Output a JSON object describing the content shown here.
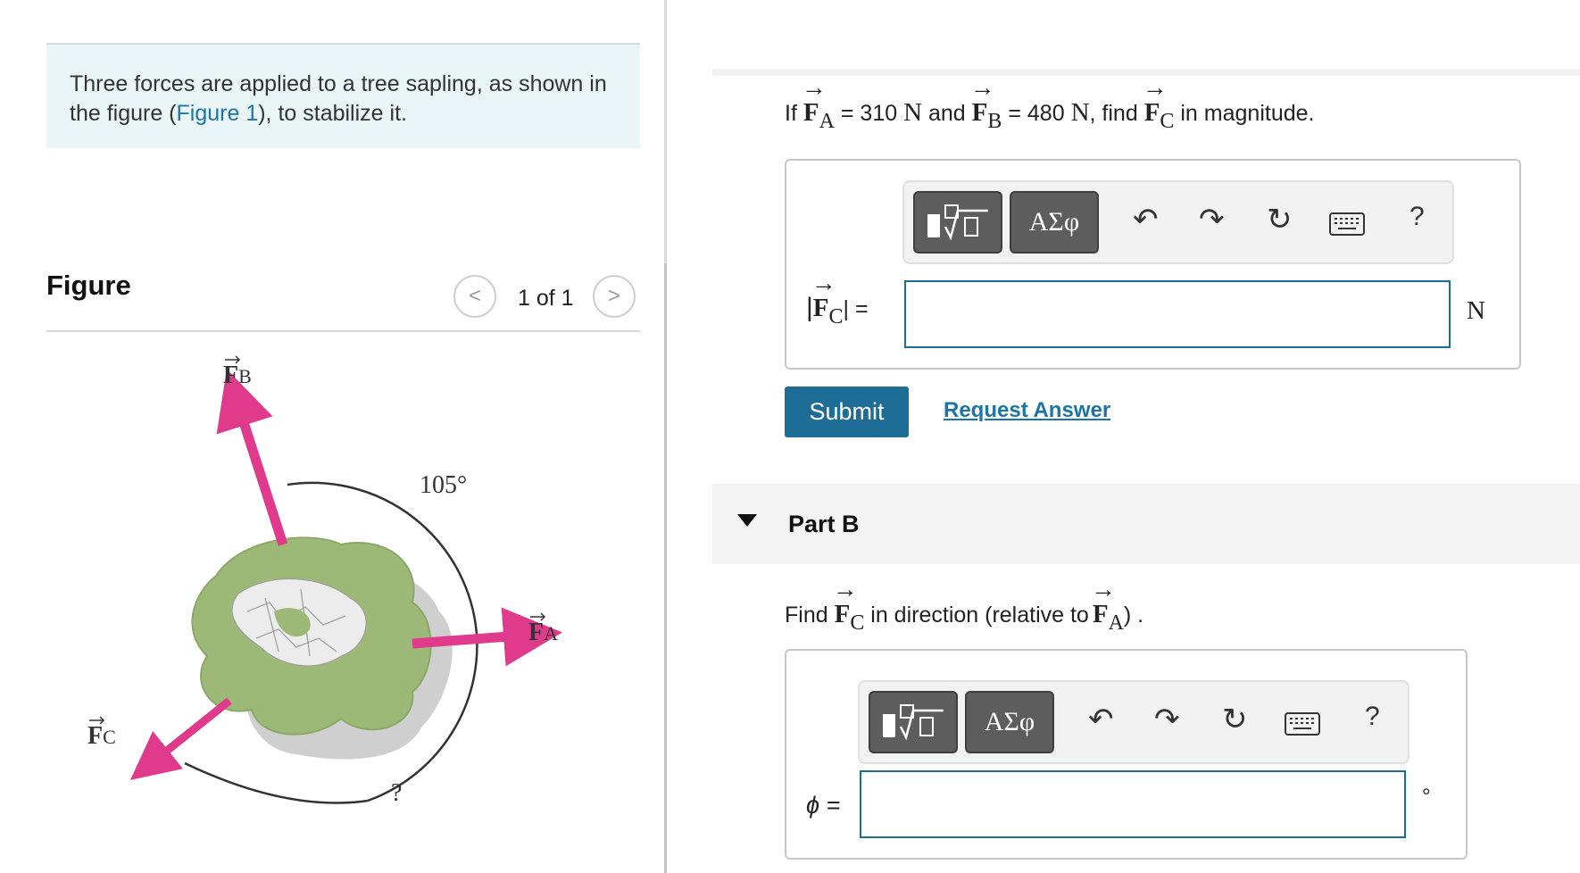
{
  "problem": {
    "text_before": "Three forces are applied to a tree sapling, as shown in the figure (",
    "link": "Figure 1",
    "text_after": "), to stabilize it."
  },
  "figure_panel": {
    "title": "Figure",
    "pager": "1 of 1",
    "prev": "<",
    "next": ">",
    "label_fb": "F",
    "label_fb_sub": "B",
    "label_fa": "F",
    "label_fa_sub": "A",
    "label_fc": "F",
    "label_fc_sub": "C",
    "angle_label": "105°",
    "unknown_angle": "?",
    "colors": {
      "arrow": "#e03a8c",
      "foliage": "#9cb978",
      "shadow": "#cfcfcf"
    }
  },
  "part_a": {
    "q_if": "If",
    "fa_letter": "F",
    "fa_sub": "A",
    "fa_eq": "= 310",
    "unit_n": "N",
    "and": "and",
    "fb_letter": "F",
    "fb_sub": "B",
    "fb_eq": "= 480",
    "find": ", find",
    "fc_letter": "F",
    "fc_sub": "C",
    "tail": "in magnitude.",
    "answer_label_letter": "F",
    "answer_label_sub": "C",
    "answer_label_eq": "| =",
    "answer_value": "",
    "answer_unit": "N",
    "submit": "Submit",
    "request": "Request Answer"
  },
  "toolbar": {
    "greek": "ΑΣφ",
    "help": "?"
  },
  "part_b": {
    "title": "Part B",
    "q_find": "Find",
    "fc_letter": "F",
    "fc_sub": "C",
    "q_mid": "in direction (relative to",
    "fa_letter": "F",
    "fa_sub": "A",
    "q_end": ") .",
    "answer_label": "ϕ =",
    "answer_value": "",
    "answer_unit": "°"
  }
}
